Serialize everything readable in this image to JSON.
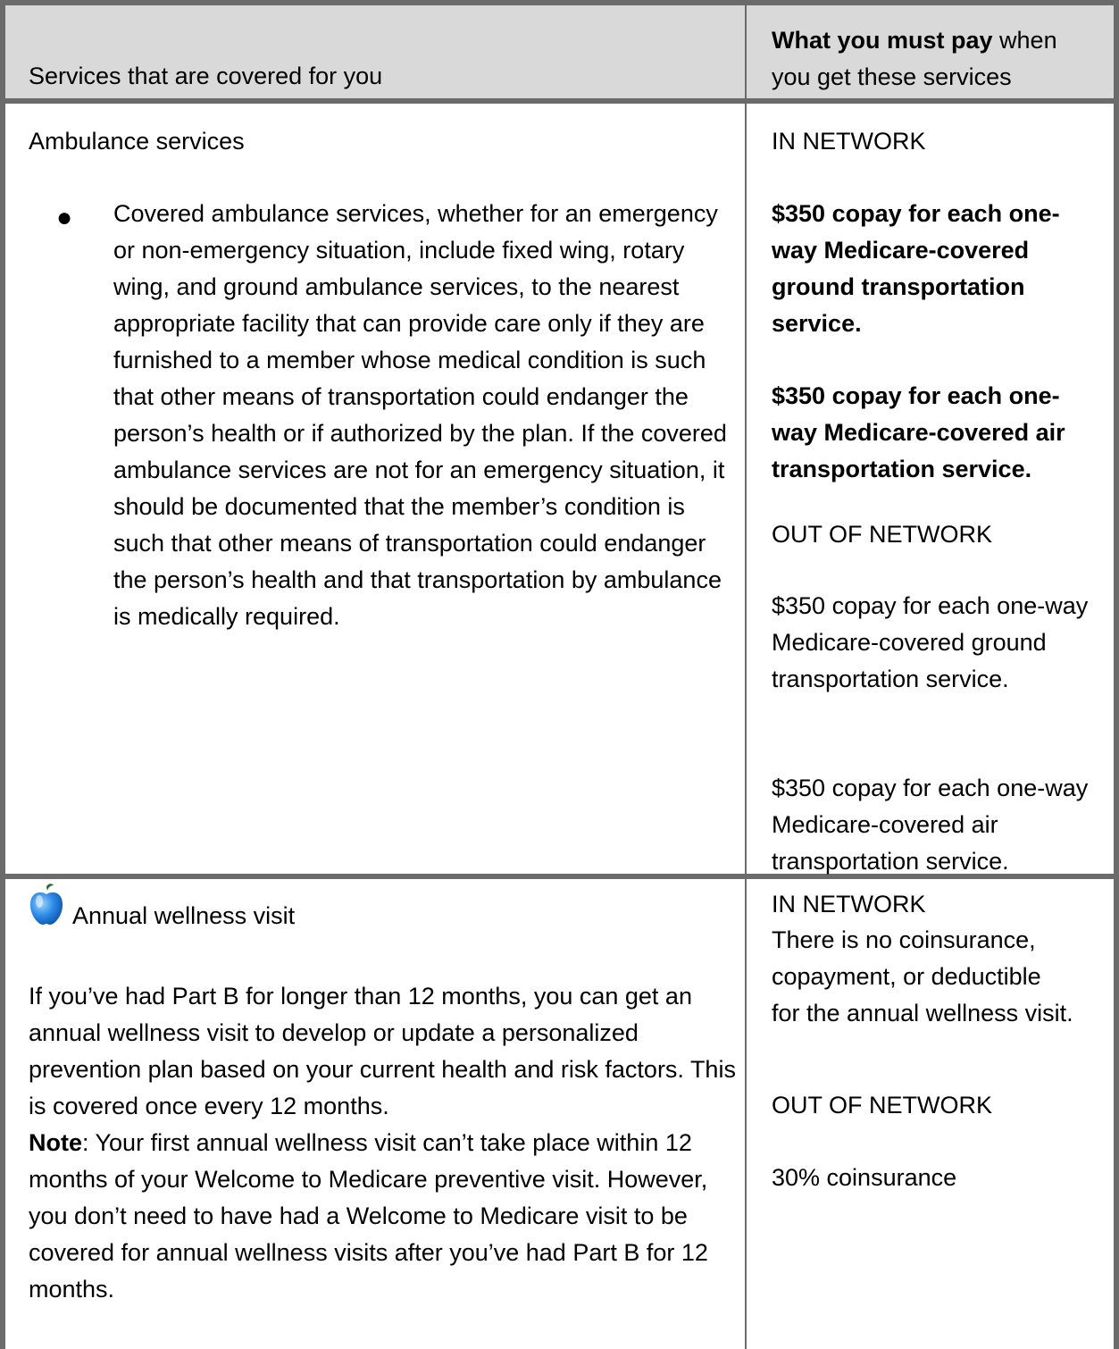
{
  "header": {
    "left": "Services that are covered for you",
    "right_bold": "What you must pay",
    "right_rest": " when you get these services"
  },
  "ambulance": {
    "title": "Ambulance services",
    "bullet": "Covered ambulance services, whether for an emergency or non-emergency situation, include fixed wing, rotary wing, and ground ambulance services, to the nearest appropriate facility that can provide care only if they are furnished to a member whose medical condition is such that other means of transportation could endanger the person’s health or if authorized by the plan. If the covered ambulance services are not for an emergency situation, it should be documented that the member’s condition is such that other means of transportation could endanger the person’s health and that transportation by ambulance is medically required.",
    "in_network_label": "IN NETWORK",
    "in_ground": "$350 copay for each one-way Medicare-covered ground transportation service.",
    "in_air": "$350 copay for each one-way Medicare-covered air transportation service.",
    "out_network_label": "OUT OF NETWORK",
    "out_ground": "$350 copay for each one-way Medicare-covered ground transportation service.",
    "out_air": "$350 copay for each one-way Medicare-covered air transportation service."
  },
  "wellness": {
    "icon": "apple-icon",
    "title": "Annual wellness visit",
    "para1": "If you’ve had Part B for longer than 12 months, you can get an annual wellness visit to develop or update a personalized prevention plan based on your current health and risk factors. This is covered once every 12 months.",
    "note_label": "Note",
    "note_text": ": Your first annual wellness visit can’t take place within 12 months of your Welcome to Medicare preventive visit. However, you don’t need to have had a Welcome to Medicare visit to be covered for annual wellness visits after you’ve had Part B for 12 months.",
    "in_network_label": "IN NETWORK",
    "in_text": "There is no coinsurance, copayment, or deductible for the annual wellness visit.",
    "out_network_label": "OUT OF NETWORK",
    "out_text": "30% coinsurance"
  }
}
